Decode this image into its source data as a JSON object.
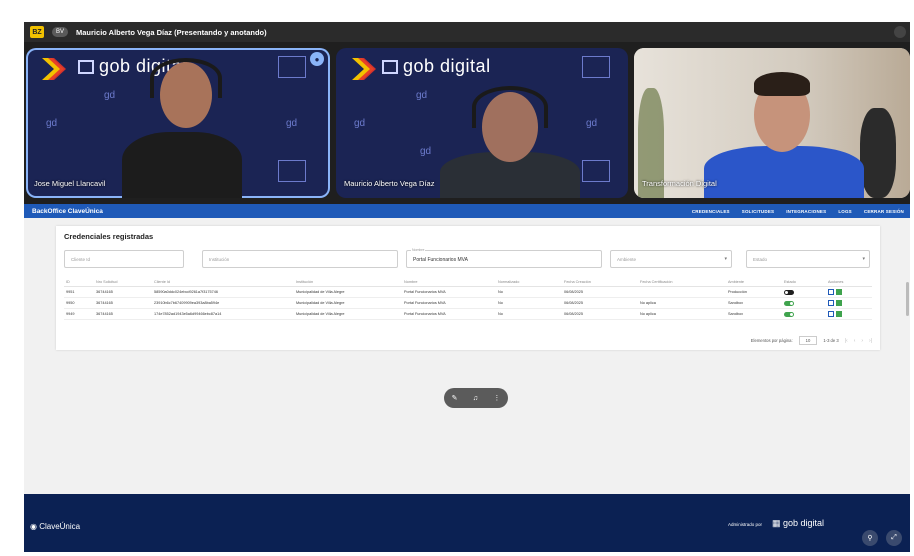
{
  "meet": {
    "badge": "BZ",
    "presenter_chip": "BV",
    "title": "Mauricio Alberto Vega Díaz (Presentando y anotando)"
  },
  "participants": [
    {
      "name": "Jose Miguel Llancavil"
    },
    {
      "name": "Mauricio Alberto Vega Díaz"
    },
    {
      "name": "Transformación Digital"
    }
  ],
  "wall_brand": "gob digital",
  "wall_small": "gd",
  "app": {
    "brand": "BackOffice ClaveÚnica",
    "nav": [
      "CREDENCIALES",
      "SOLICITUDES",
      "INTEGRACIONES",
      "LOGS",
      "CERRAR SESIÓN"
    ],
    "card_title": "Credenciales registradas",
    "filters": {
      "cliente_placeholder": "Cliente Id",
      "institucion_placeholder": "Institución",
      "nombre_label": "Nombre",
      "nombre_value": "Portal Funcionarios MVA",
      "ambiente_placeholder": "Ambiente",
      "estado_placeholder": "Estado"
    },
    "columns": [
      "ID",
      "Nro Solicitud",
      "Cliente Id",
      "Institución",
      "Nombre",
      "Normalizado",
      "Fecha Creación",
      "Fecha Certificación",
      "Ambiente",
      "Estado",
      "Acciones"
    ],
    "rows": [
      {
        "id": "9951",
        "solicitud": "36744165",
        "cliente": "58590a0ddc024ebcd9261a7f3175746",
        "institucion": "Municipalidad de Villa Alegre",
        "nombre": "Portal Funcionarios MVA",
        "normalizado": "No",
        "creacion": "06/08/2025",
        "certificacion": "",
        "ambiente": "Producción",
        "estado": "off"
      },
      {
        "id": "9950",
        "solicitud": "36744165",
        "cliente": "23910b6c7b67409909ea393a8ba594e",
        "institucion": "Municipalidad de Villa Alegre",
        "nombre": "Portal Funcionarios MVA",
        "normalizado": "No",
        "creacion": "06/08/2025",
        "certificacion": "No aplica",
        "ambiente": "Sandbox",
        "estado": "on"
      },
      {
        "id": "9949",
        "solicitud": "36744165",
        "cliente": "174e7852ad1943e5a6d99466ebc87a14",
        "institucion": "Municipalidad de Villa Alegre",
        "nombre": "Portal Funcionarios MVA",
        "normalizado": "No",
        "creacion": "06/08/2025",
        "certificacion": "No aplica",
        "ambiente": "Sandbox",
        "estado": "on"
      }
    ],
    "pager": {
      "label": "Elementos por página:",
      "size": "10",
      "range": "1-3 de 3"
    }
  },
  "footer": {
    "brand": "ClaveÚnica",
    "admin_label": "Administrado por",
    "admin_logo": "gob digital"
  },
  "colors": {
    "nav": "#1f5ab8",
    "footer": "#0b2153",
    "toggle_on": "#3fa34d",
    "speaking": "#8ab4f8"
  }
}
